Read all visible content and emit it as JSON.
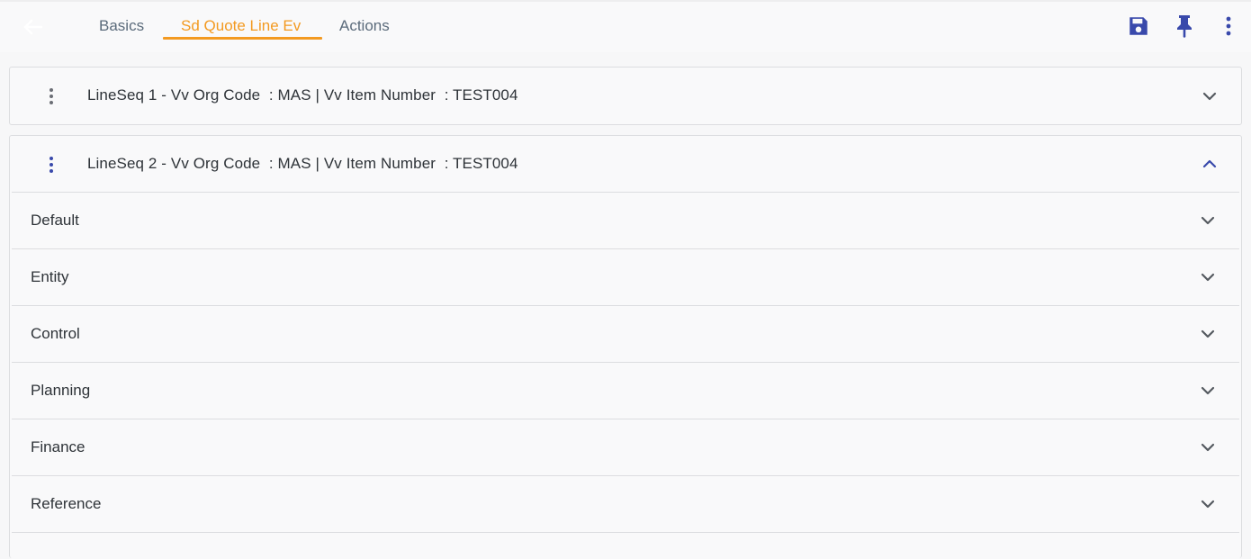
{
  "tabs": [
    {
      "label": "Basics"
    },
    {
      "label": "Sd Quote Line Ev"
    },
    {
      "label": "Actions"
    }
  ],
  "active_tab": "Sd Quote Line Ev",
  "icons": {
    "back": "arrow-left-icon",
    "save": "save-icon",
    "pin": "pin-icon",
    "more": "more-vert-icon"
  },
  "colors": {
    "accent": "#f39a21",
    "primary": "#3949ab",
    "tab_text": "#5b6b7b",
    "body_text": "#2e3338"
  },
  "lines": [
    {
      "title": "LineSeq 1 - Vv Org Code  : MAS | Vv Item Number  : TEST004",
      "expanded": false
    },
    {
      "title": "LineSeq 2 - Vv Org Code  : MAS | Vv Item Number  : TEST004",
      "expanded": true
    }
  ],
  "sections": [
    {
      "label": "Default"
    },
    {
      "label": "Entity"
    },
    {
      "label": "Control"
    },
    {
      "label": "Planning"
    },
    {
      "label": "Finance"
    },
    {
      "label": "Reference"
    }
  ]
}
